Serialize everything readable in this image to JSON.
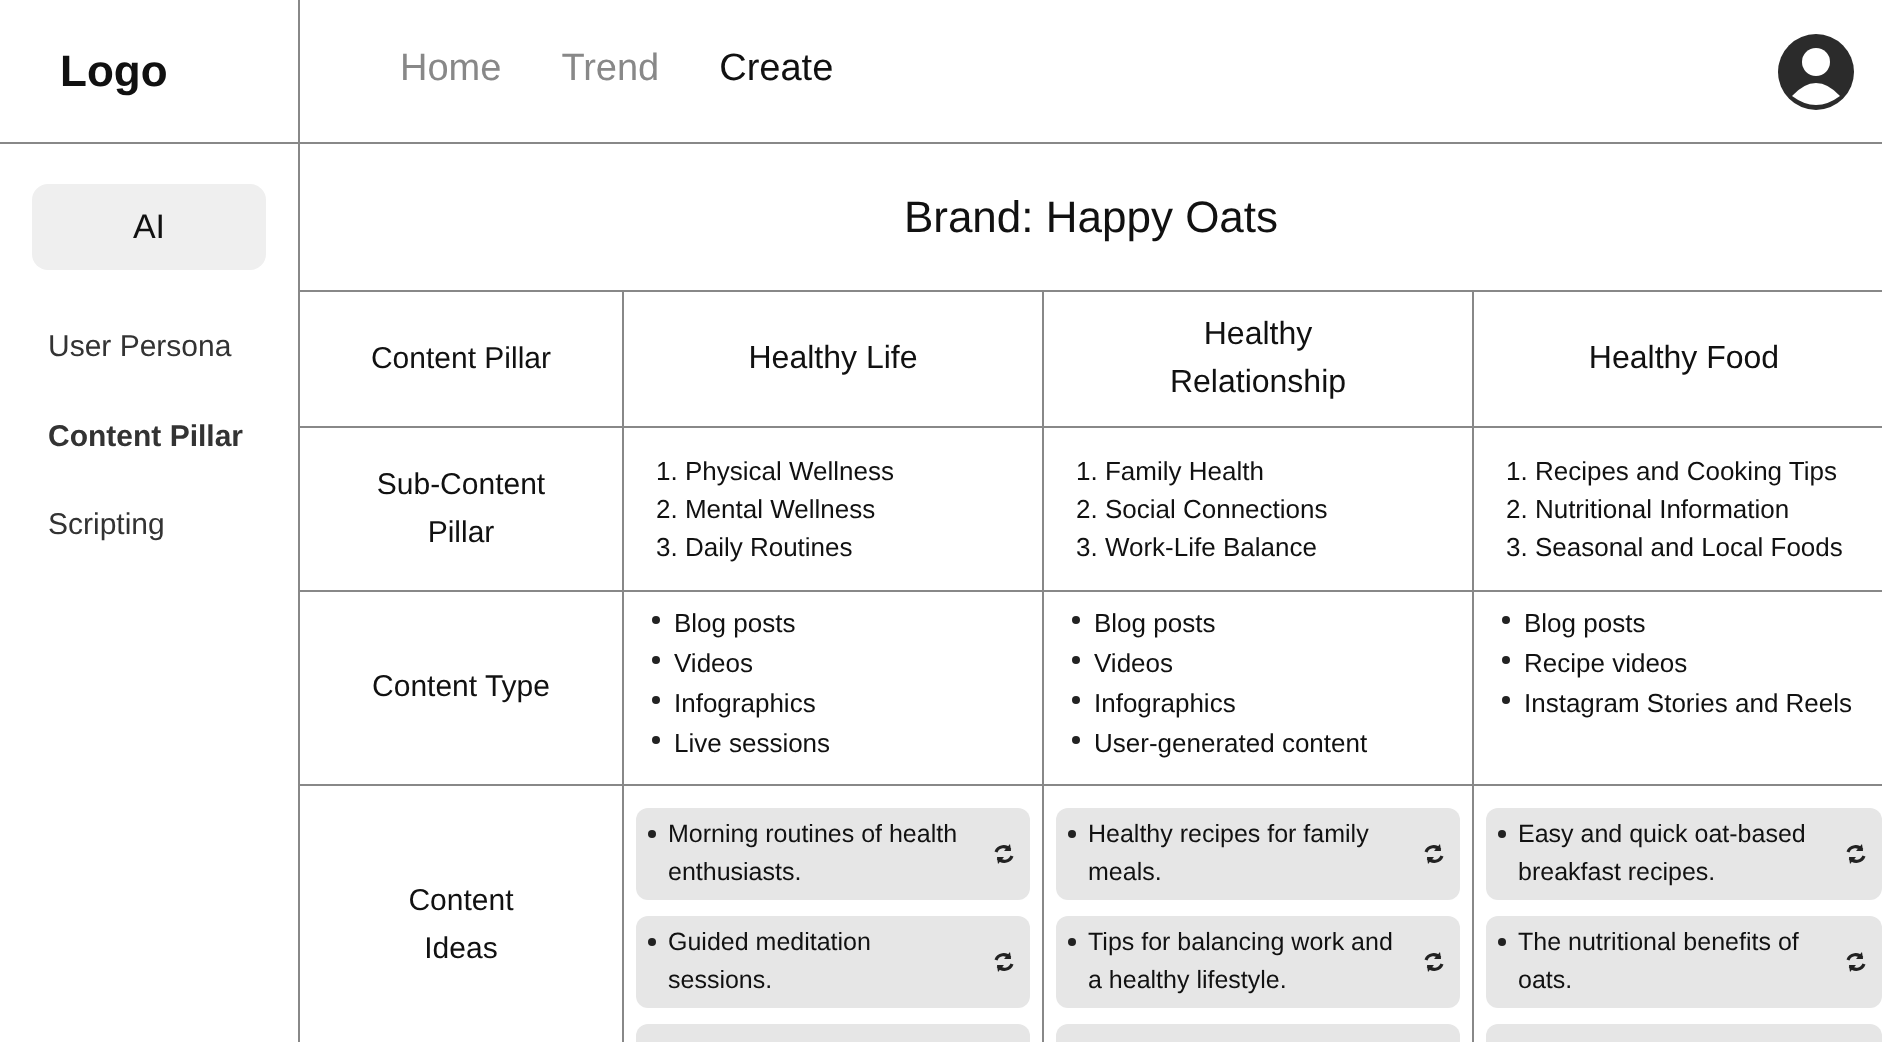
{
  "logo": "Logo",
  "nav": [
    {
      "label": "Home",
      "selected": false
    },
    {
      "label": "Trend",
      "selected": false
    },
    {
      "label": "Create",
      "selected": true
    }
  ],
  "sidebar": {
    "button": "AI",
    "items": [
      {
        "label": "User Persona",
        "selected": false
      },
      {
        "label": "Content Pillar",
        "selected": true
      },
      {
        "label": "Scripting",
        "selected": false
      }
    ]
  },
  "brand_title": "Brand: Happy Oats",
  "rows": [
    {
      "kind": "header",
      "label": "Content Pillar",
      "cells": [
        {
          "title": "Healthy Life"
        },
        {
          "title": "Healthy Relationship"
        },
        {
          "title": "Healthy Food"
        }
      ]
    },
    {
      "kind": "numbered",
      "label": "Sub-Content Pillar",
      "cells": [
        {
          "items": [
            "1. Physical Wellness",
            "2. Mental Wellness",
            "3. Daily Routines"
          ]
        },
        {
          "items": [
            "1. Family Health",
            "2. Social Connections",
            "3. Work-Life Balance"
          ]
        },
        {
          "items": [
            "1. Recipes and Cooking Tips",
            "2. Nutritional Information",
            "3. Seasonal and Local Foods"
          ]
        }
      ]
    },
    {
      "kind": "bullets",
      "label": "Content Type",
      "cells": [
        {
          "items": [
            "Blog posts",
            "Videos",
            "Infographics",
            "Live sessions"
          ]
        },
        {
          "items": [
            "Blog posts",
            "Videos",
            "Infographics",
            "User-generated content"
          ]
        },
        {
          "items": [
            "Blog posts",
            "Recipe videos",
            "Instagram Stories and Reels"
          ]
        }
      ]
    },
    {
      "kind": "ideas",
      "label": "Content Ideas",
      "cells": [
        {
          "items": [
            "Morning routines of health enthusiasts.",
            "Guided meditation sessions."
          ]
        },
        {
          "items": [
            "Healthy recipes for family meals.",
            "Tips for balancing work and a healthy lifestyle."
          ]
        },
        {
          "items": [
            "Easy and quick oat-based breakfast recipes.",
            "The nutritional benefits of oats."
          ]
        }
      ]
    }
  ]
}
